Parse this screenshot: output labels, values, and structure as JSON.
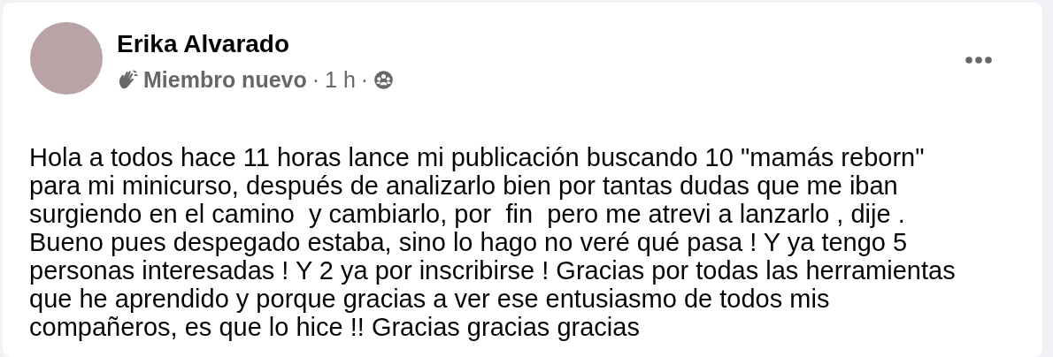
{
  "post": {
    "author": "Erika Alvarado",
    "badge": "Miembro nuevo",
    "separator_1": "·",
    "time": "1 h",
    "separator_2": "·",
    "text": "Hola a todos hace 11 horas lance mi publicación buscando 10 \"mamás reborn\"\npara mi minicurso, después de analizarlo bien por tantas dudas que me iban\nsurgiendo en el camino  y cambiarlo, por  fin  pero me atrevi a lanzarlo , dije .\nBueno pues despegado estaba, sino lo hago no veré qué pasa ! Y ya tengo 5\npersonas interesadas ! Y 2 ya por inscribirse ! Gracias por todas las herramientas\nque he aprendido y porque gracias a ver ese entusiasmo de todos mis\ncompañeros, es que lo hice !! Gracias gracias gracias"
  }
}
